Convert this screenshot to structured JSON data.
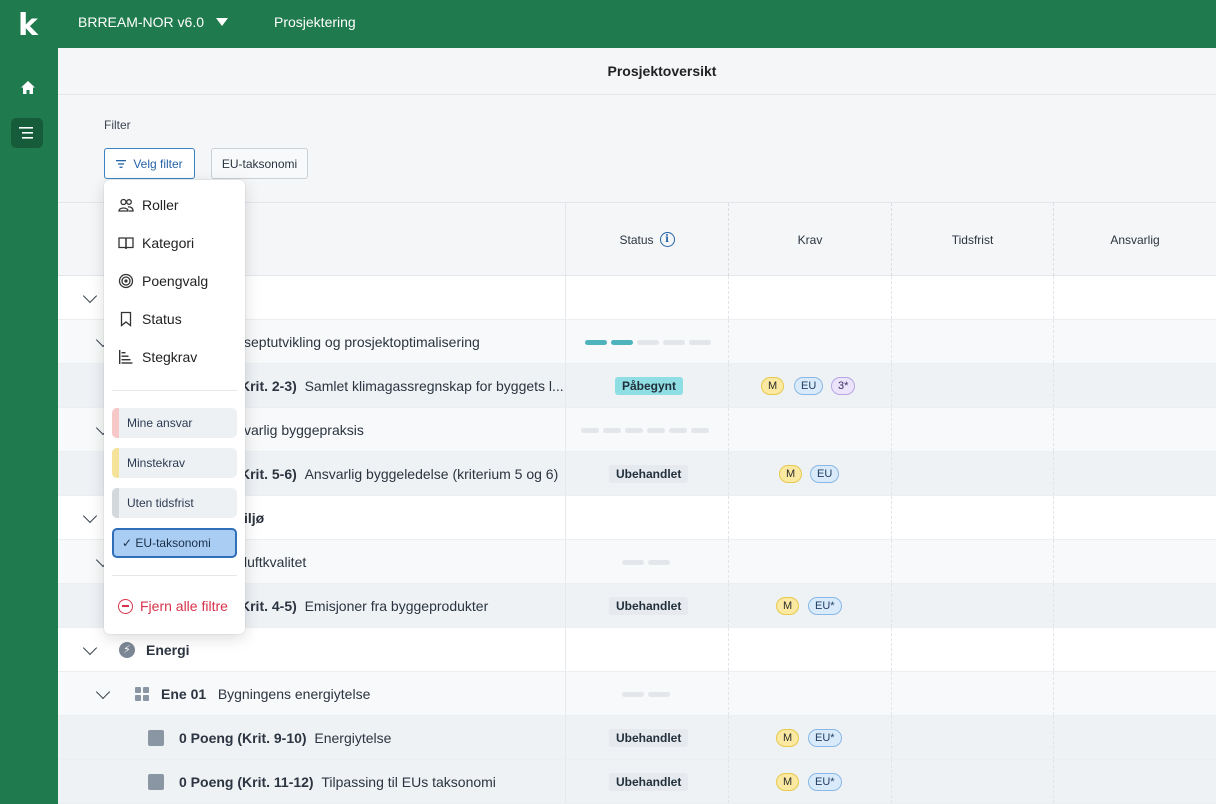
{
  "topbar": {
    "logo": "k",
    "project": "BRREAM-NOR v6.0",
    "phase": "Prosjektering"
  },
  "page": {
    "title": "Prosjektoversikt"
  },
  "filter": {
    "label": "Filter",
    "select_button": "Velg filter",
    "active_chip": "EU-taksonomi"
  },
  "table": {
    "columns": {
      "status": "Status",
      "krav": "Krav",
      "tidsfrist": "Tidsfrist",
      "ansvarlig": "Ansvarlig"
    },
    "rows": [
      {
        "text": ""
      },
      {
        "text": "septutvikling og prosjektoptimalisering"
      },
      {
        "bold": "Krit. 2-3)",
        "text": "Samlet klimagassregnskap for byggets l...",
        "status": "Påbegynt",
        "krav": [
          "M",
          "EU",
          "3*"
        ]
      },
      {
        "text": "varlig byggepraksis"
      },
      {
        "bold": "Krit. 5-6)",
        "text": "Ansvarlig byggeledelse (kriterium 5 og 6)",
        "status": "Ubehandlet",
        "krav": [
          "M",
          "EU"
        ]
      },
      {
        "bold": "iljø"
      },
      {
        "text": "luftkvalitet"
      },
      {
        "bold": "Krit. 4-5)",
        "text": "Emisjoner fra byggeprodukter",
        "status": "Ubehandlet",
        "krav": [
          "M",
          "EU*"
        ]
      },
      {
        "bold": "Energi"
      },
      {
        "bold": "Ene 01",
        "text": "Bygningens energiytelse"
      },
      {
        "bold": "0 Poeng (Krit. 9-10)",
        "text": "Energiytelse",
        "status": "Ubehandlet",
        "krav": [
          "M",
          "EU*"
        ]
      },
      {
        "bold": "0 Poeng (Krit. 11-12)",
        "text": "Tilpassing til EUs taksonomi",
        "status": "Ubehandlet",
        "krav": [
          "M",
          "EU*"
        ]
      }
    ]
  },
  "dropdown": {
    "items": [
      "Roller",
      "Kategori",
      "Poengvalg",
      "Status",
      "Stegkrav"
    ],
    "quick_filters": [
      "Mine ansvar",
      "Minstekrav",
      "Uten tidsfrist",
      "EU-taksonomi"
    ],
    "remove_all": "Fjern alle filtre"
  },
  "colors": {
    "brand_green": "#1f7a4d",
    "accent_blue": "#2563a8",
    "danger_red": "#d8334a"
  }
}
